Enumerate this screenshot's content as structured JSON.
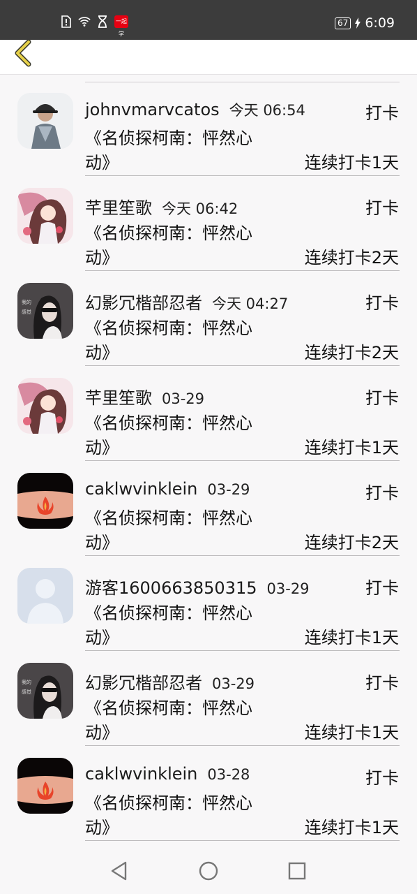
{
  "status_bar": {
    "time": "6:09",
    "battery": "67",
    "app_badge_text": "一起学"
  },
  "nav": {
    "back_icon": "chevron-left-icon",
    "nav_back_icon": "triangle-back-icon",
    "nav_home_icon": "circle-home-icon",
    "nav_recent_icon": "square-recent-icon"
  },
  "colors": {
    "back_chevron": "#e8d24a",
    "status_bg": "#3c3c3c",
    "badge": "#e60012"
  },
  "rows": [
    {
      "name": "johnvmarvcatos",
      "time": "今天 06:54",
      "action": "打卡",
      "title_line1": "《名侦探柯南：怦然心",
      "title_line2": "动》",
      "streak": "连续打卡1天",
      "avatar": "person-hat"
    },
    {
      "name": "芊里笙歌",
      "time": "今天 06:42",
      "action": "打卡",
      "title_line1": "《名侦探柯南：怦然心",
      "title_line2": "动》",
      "streak": "连续打卡2天",
      "avatar": "anime-girl"
    },
    {
      "name": "幻影冗楷部忍者",
      "time": "今天 04:27",
      "action": "打卡",
      "title_line1": "《名侦探柯南：怦然心",
      "title_line2": "动》",
      "streak": "连续打卡2天",
      "avatar": "sunglasses-girl"
    },
    {
      "name": "芊里笙歌",
      "time": "03-29",
      "action": "打卡",
      "title_line1": "《名侦探柯南：怦然心",
      "title_line2": "动》",
      "streak": "连续打卡1天",
      "avatar": "anime-girl"
    },
    {
      "name": "caklwvinklein",
      "time": "03-29",
      "action": "打卡",
      "title_line1": "《名侦探柯南：怦然心",
      "title_line2": "动》",
      "streak": "连续打卡2天",
      "avatar": "flame-wrist"
    },
    {
      "name": "游客1600663850315",
      "time": "03-29",
      "action": "打卡",
      "title_line1": "《名侦探柯南：怦然心",
      "title_line2": "动》",
      "streak": "连续打卡1天",
      "avatar": "default-user"
    },
    {
      "name": "幻影冗楷部忍者",
      "time": "03-29",
      "action": "打卡",
      "title_line1": "《名侦探柯南：怦然心",
      "title_line2": "动》",
      "streak": "连续打卡1天",
      "avatar": "sunglasses-girl"
    },
    {
      "name": "caklwvinklein",
      "time": "03-28",
      "action": "打卡",
      "title_line1": "《名侦探柯南：怦然心",
      "title_line2": "动》",
      "streak": "连续打卡1天",
      "avatar": "flame-wrist"
    }
  ]
}
